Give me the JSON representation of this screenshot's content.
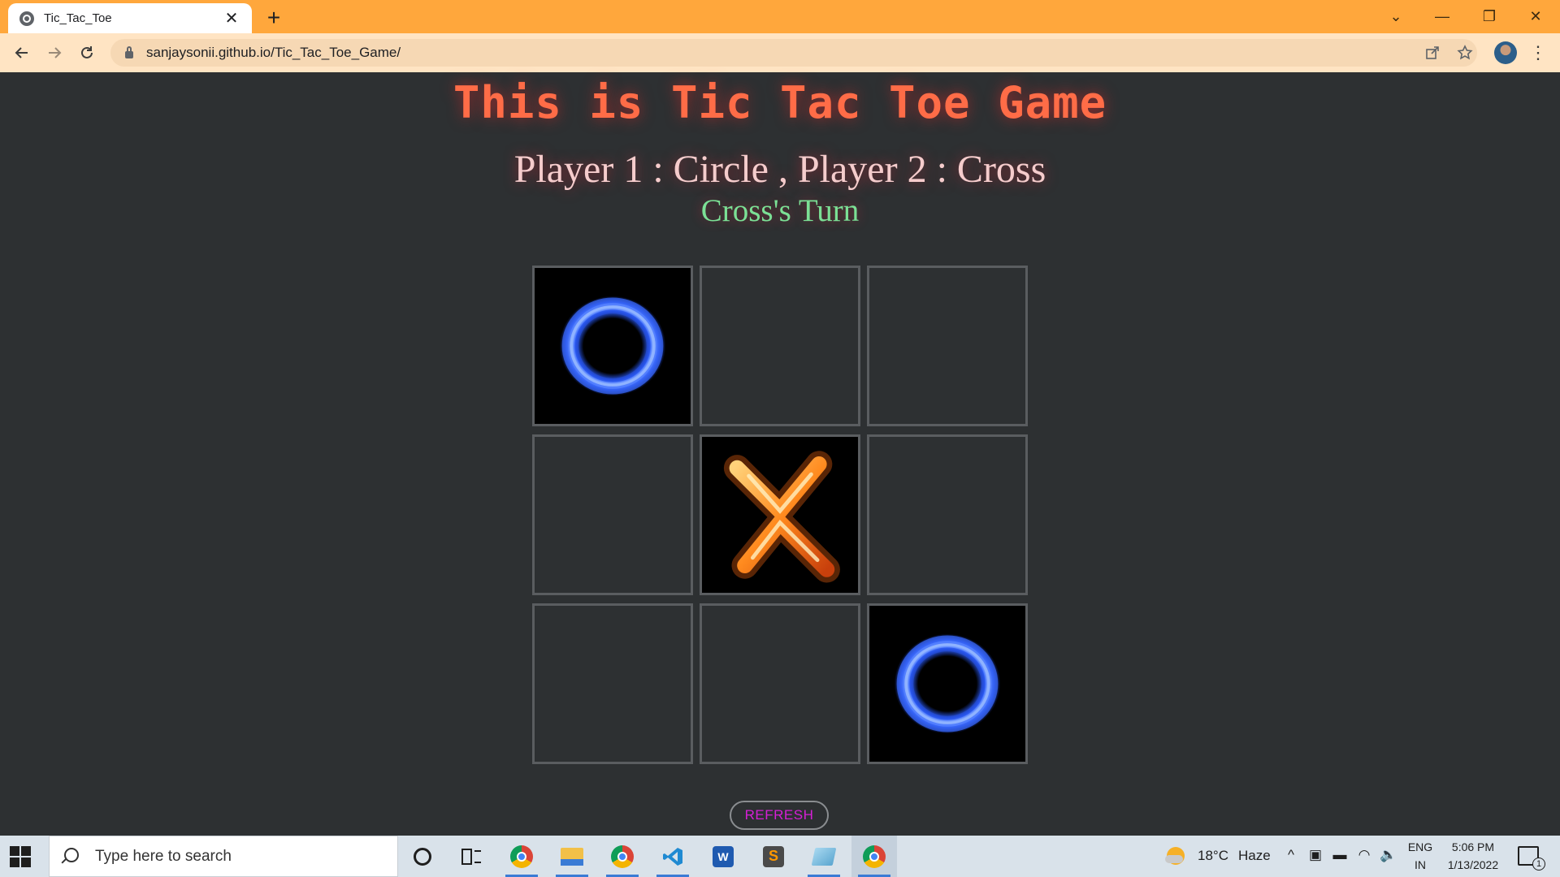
{
  "browser": {
    "tab_title": "Tic_Tac_Toe",
    "tab_close_glyph": "✕",
    "new_tab_glyph": "+",
    "url": "sanjaysonii.github.io/Tic_Tac_Toe_Game/",
    "window_controls": {
      "tabsearch": "⌄",
      "minimize": "—",
      "restore": "❐",
      "close": "✕"
    },
    "accent_color": "#ffa73c",
    "toolbar_color": "#ffe4c3"
  },
  "page": {
    "title": "This is Tic Tac Toe Game",
    "players": "Player 1 : Circle , Player 2 : Cross",
    "turn": "Cross's Turn",
    "refresh_label": "REFRESH",
    "colors": {
      "background": "#2d3032",
      "title": "#ff6c47",
      "players": "#f5cccc",
      "turn": "#7be095",
      "refresh_text": "#d61fd6"
    },
    "board": [
      [
        "O",
        "",
        ""
      ],
      [
        "",
        "X",
        ""
      ],
      [
        "",
        "",
        "O"
      ]
    ]
  },
  "taskbar": {
    "search_placeholder": "Type here to search",
    "pinned_icons": [
      "chrome-icon",
      "file-explorer-icon",
      "chrome-icon",
      "vscode-icon",
      "word-icon",
      "sublime-text-icon",
      "notes-app-icon",
      "chrome-icon"
    ],
    "weather_temp": "18°C",
    "weather_desc": "Haze",
    "language": "ENG",
    "region": "IN",
    "time": "5:06 PM",
    "date": "1/13/2022",
    "notification_count": "1"
  }
}
